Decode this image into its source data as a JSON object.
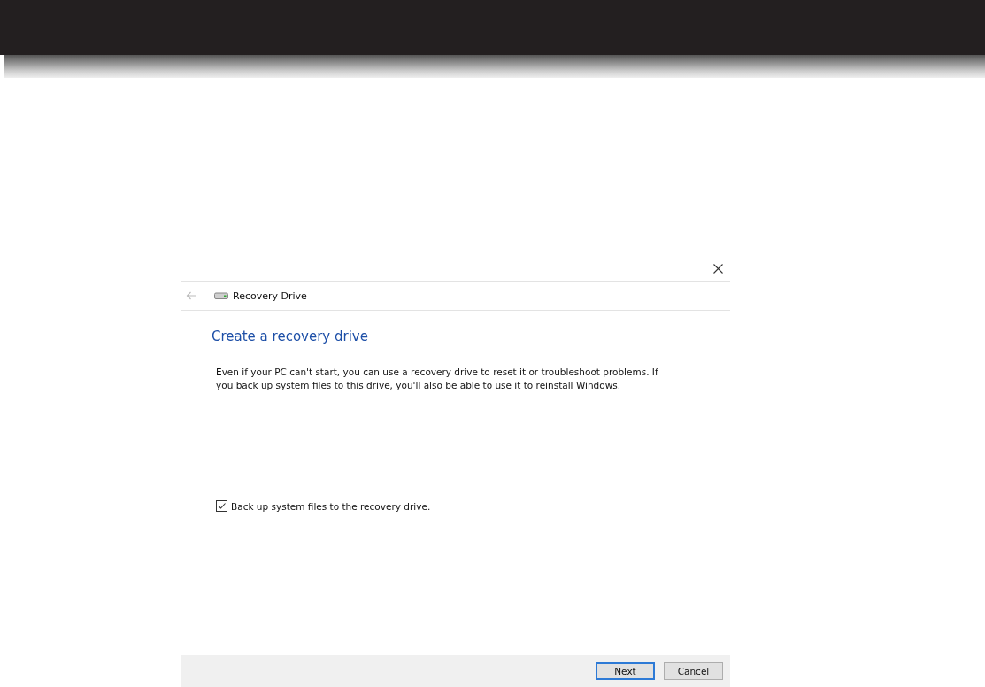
{
  "dialog": {
    "nav_title": "Recovery Drive",
    "heading": "Create a recovery drive",
    "description": "Even if your PC can't start, you can use a recovery drive to reset it or troubleshoot problems. If you back up system files to this drive, you'll also be able to use it to reinstall Windows.",
    "backup_option": {
      "label": "Back up system files to the recovery drive.",
      "checked": true
    },
    "buttons": [
      {
        "label": "Next",
        "default": true
      },
      {
        "label": "Cancel",
        "default": false
      }
    ]
  }
}
